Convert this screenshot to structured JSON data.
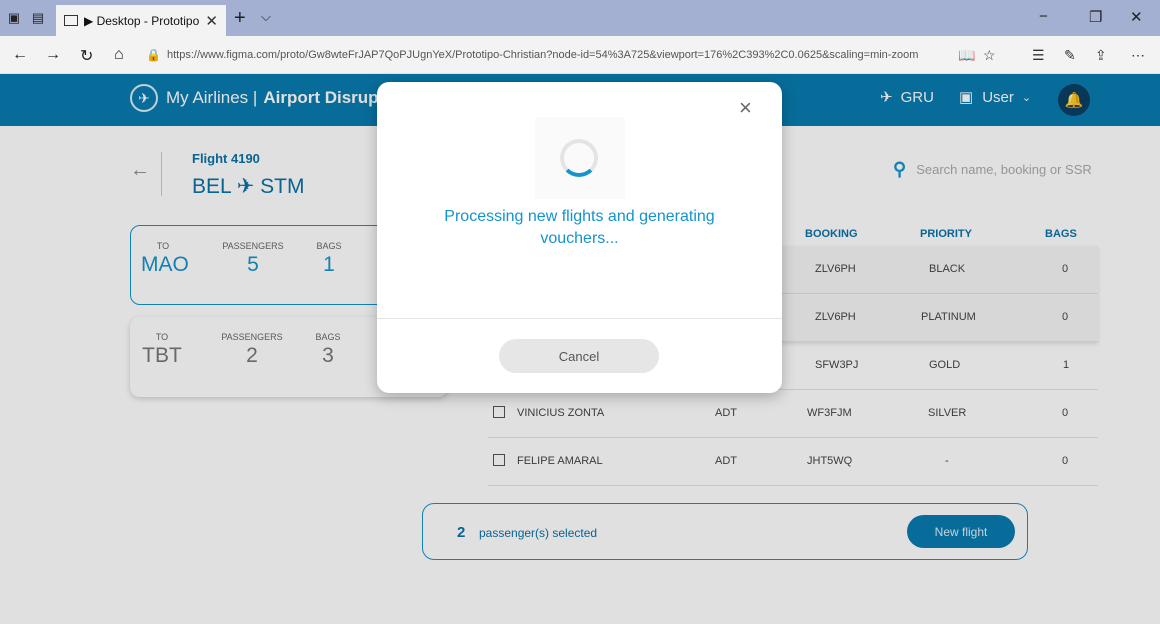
{
  "browser": {
    "tab_title": "▶ Desktop - Prototipo (",
    "url": "https://www.figma.com/proto/Gw8wteFrJAP7QoPJUgnYeX/Prototipo-Christian?node-id=54%3A725&viewport=176%2C393%2C0.0625&scaling=min-zoom"
  },
  "app": {
    "brand_name": "My Airlines |",
    "brand_section": "Airport Disruptio",
    "airport": "GRU",
    "user": "User",
    "colors": {
      "primary": "#0a7bb0",
      "accent": "#1593cd",
      "dark": "#0b3f63"
    }
  },
  "flight": {
    "label": "Flight 4190",
    "route": "BEL ✈ STM"
  },
  "search": {
    "placeholder": "Search name, booking or SSR"
  },
  "groups": [
    {
      "to_label": "TO",
      "to": "MAO",
      "pax_label": "PASSENGERS",
      "pax": "5",
      "bags_label": "BAGS",
      "bags": "1"
    },
    {
      "to_label": "TO",
      "to": "TBT",
      "pax_label": "PASSENGERS",
      "pax": "2",
      "bags_label": "BAGS",
      "bags": "3"
    }
  ],
  "table": {
    "headers": {
      "booking": "BOOKING",
      "priority": "PRIORITY",
      "bags": "BAGS"
    },
    "rows": [
      {
        "name": "",
        "type": "",
        "booking": "ZLV6PH",
        "priority": "BLACK",
        "bags": "0"
      },
      {
        "name": "",
        "type": "",
        "booking": "ZLV6PH",
        "priority": "PLATINUM",
        "bags": "0"
      },
      {
        "name": "",
        "type": "",
        "booking": "SFW3PJ",
        "priority": "GOLD",
        "bags": "1"
      },
      {
        "name": "VINICIUS ZONTA",
        "type": "ADT",
        "booking": "WF3FJM",
        "priority": "SILVER",
        "bags": "0"
      },
      {
        "name": "FELIPE AMARAL",
        "type": "ADT",
        "booking": "JHT5WQ",
        "priority": "-",
        "bags": "0"
      }
    ]
  },
  "selection": {
    "count": "2",
    "text": "passenger(s) selected",
    "button": "New flight"
  },
  "modal": {
    "message": "Processing new flights and generating vouchers...",
    "cancel": "Cancel",
    "close": "×"
  }
}
